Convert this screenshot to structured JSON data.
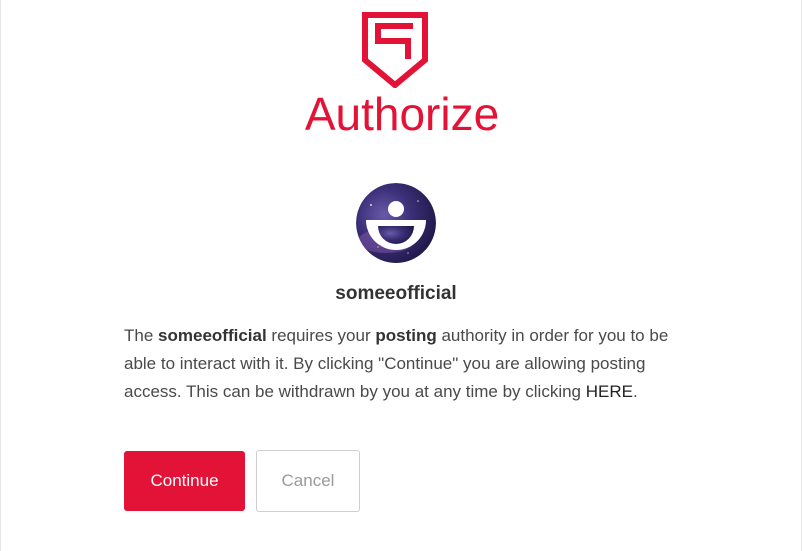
{
  "header": {
    "logo_icon": "steem-shield-logo-icon",
    "title": "Authorize",
    "brand_color": "#e31337"
  },
  "account": {
    "avatar_icon": "someeofficial-avatar",
    "username": "someeofficial"
  },
  "message": {
    "part1": "The ",
    "account_name": "someeofficial",
    "part2": " requires your ",
    "authority": "posting",
    "part3": " authority in order for you to be able to interact with it. By clicking \"Continue\" you are allowing posting access. This can be withdrawn by you at any time by clicking ",
    "link_text": "HERE",
    "part4": "."
  },
  "buttons": {
    "continue_label": "Continue",
    "cancel_label": "Cancel"
  }
}
